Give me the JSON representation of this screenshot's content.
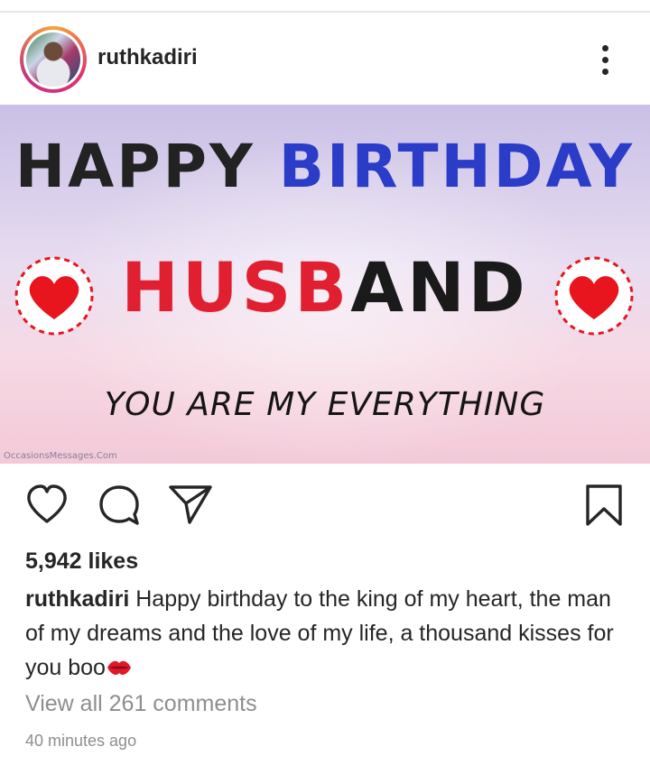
{
  "post": {
    "username": "ruthkadiri",
    "image": {
      "line1_black": "HAPPY ",
      "line1_blue": "BIRTHDAY",
      "line2_red": "HUSB",
      "line2_black": "AND",
      "line3": "YOU ARE MY EVERYTHING",
      "watermark": "OccasionsMessages.Com"
    },
    "likes": "5,942 likes",
    "caption": {
      "user": "ruthkadiri",
      "text": "Happy birthday to the king of my heart, the man of my dreams and the love of my life, a thousand kisses for you boo"
    },
    "view_comments": "View all 261 comments",
    "timestamp": "40 minutes ago"
  },
  "icons": {
    "more": "more-vertical-icon",
    "like": "heart-outline-icon",
    "comment": "comment-bubble-icon",
    "share": "paper-plane-icon",
    "save": "bookmark-icon",
    "emoji": "kiss-mark-icon"
  },
  "colors": {
    "text": "#262626",
    "muted": "#8e8e8e",
    "heart_red": "#e8141e",
    "title_blue": "#2a3cc8",
    "title_red": "#e02030"
  }
}
